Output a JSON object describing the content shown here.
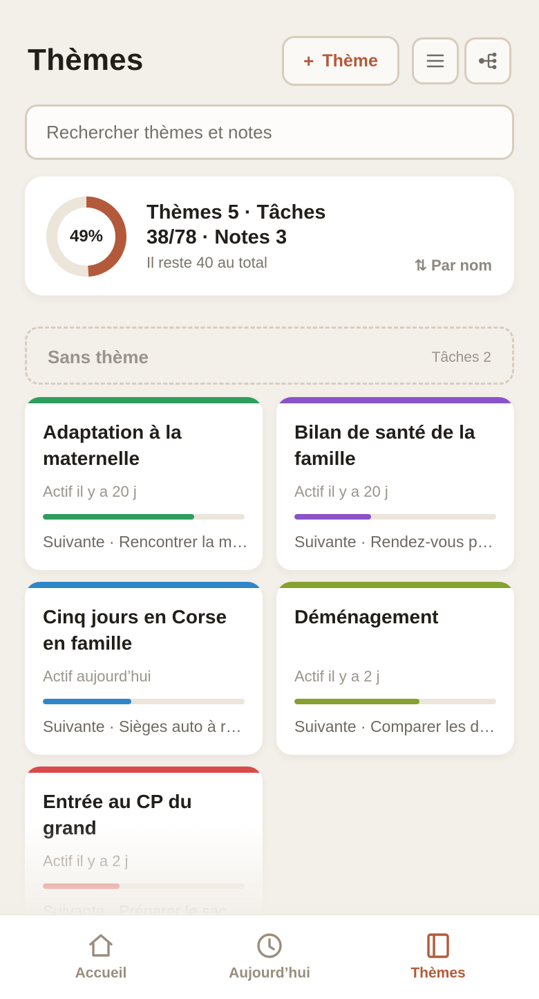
{
  "header": {
    "title": "Thèmes",
    "add_theme_label": "Thème",
    "add_theme_plus": "+",
    "list_icon": "list-icon",
    "tree_icon": "tree-icon"
  },
  "search": {
    "placeholder": "Rechercher thèmes et notes",
    "value": ""
  },
  "summary": {
    "progress_percent": 49,
    "progress_label": "49%",
    "stats": "Thèmes 5 · Tâches 38/78 · Notes 3",
    "remaining": "Il reste 40 au total",
    "sort_label": "⇅ Par nom"
  },
  "no_theme": {
    "title": "Sans thème",
    "count": "Tâches 2"
  },
  "themes": [
    {
      "title": "Adaptation à la maternelle",
      "active": "Actif il y a 20 j",
      "progress": 0.75,
      "next": "Suivante · Rencontrer la maîtresse",
      "color": "#2e9d5e"
    },
    {
      "title": "Bilan de santé de la famille",
      "active": "Actif il y a 20 j",
      "progress": 0.38,
      "next": "Suivante · Rendez-vous pédiatre",
      "color": "#8a53c9"
    },
    {
      "title": "Cinq jours en Corse en famille",
      "active": "Actif aujourd’hui",
      "progress": 0.44,
      "next": "Suivante · Sièges auto à réserver",
      "color": "#2f86c8"
    },
    {
      "title": "Déménagement",
      "active": "Actif il y a 2 j",
      "progress": 0.62,
      "next": "Suivante · Comparer les devis",
      "color": "#87a12e"
    },
    {
      "title": "Entrée au CP du grand",
      "active": "Actif il y a 2 j",
      "progress": 0.38,
      "next": "Suivante · Préparer le sac",
      "color": "#d94a4a"
    }
  ],
  "nav": {
    "home_label": "Accueil",
    "today_label": "Aujourd’hui",
    "themes_label": "Thèmes",
    "active": "themes"
  },
  "colors": {
    "accent": "#b35a3b",
    "background": "#f3efe9",
    "track": "#ebe5da"
  }
}
